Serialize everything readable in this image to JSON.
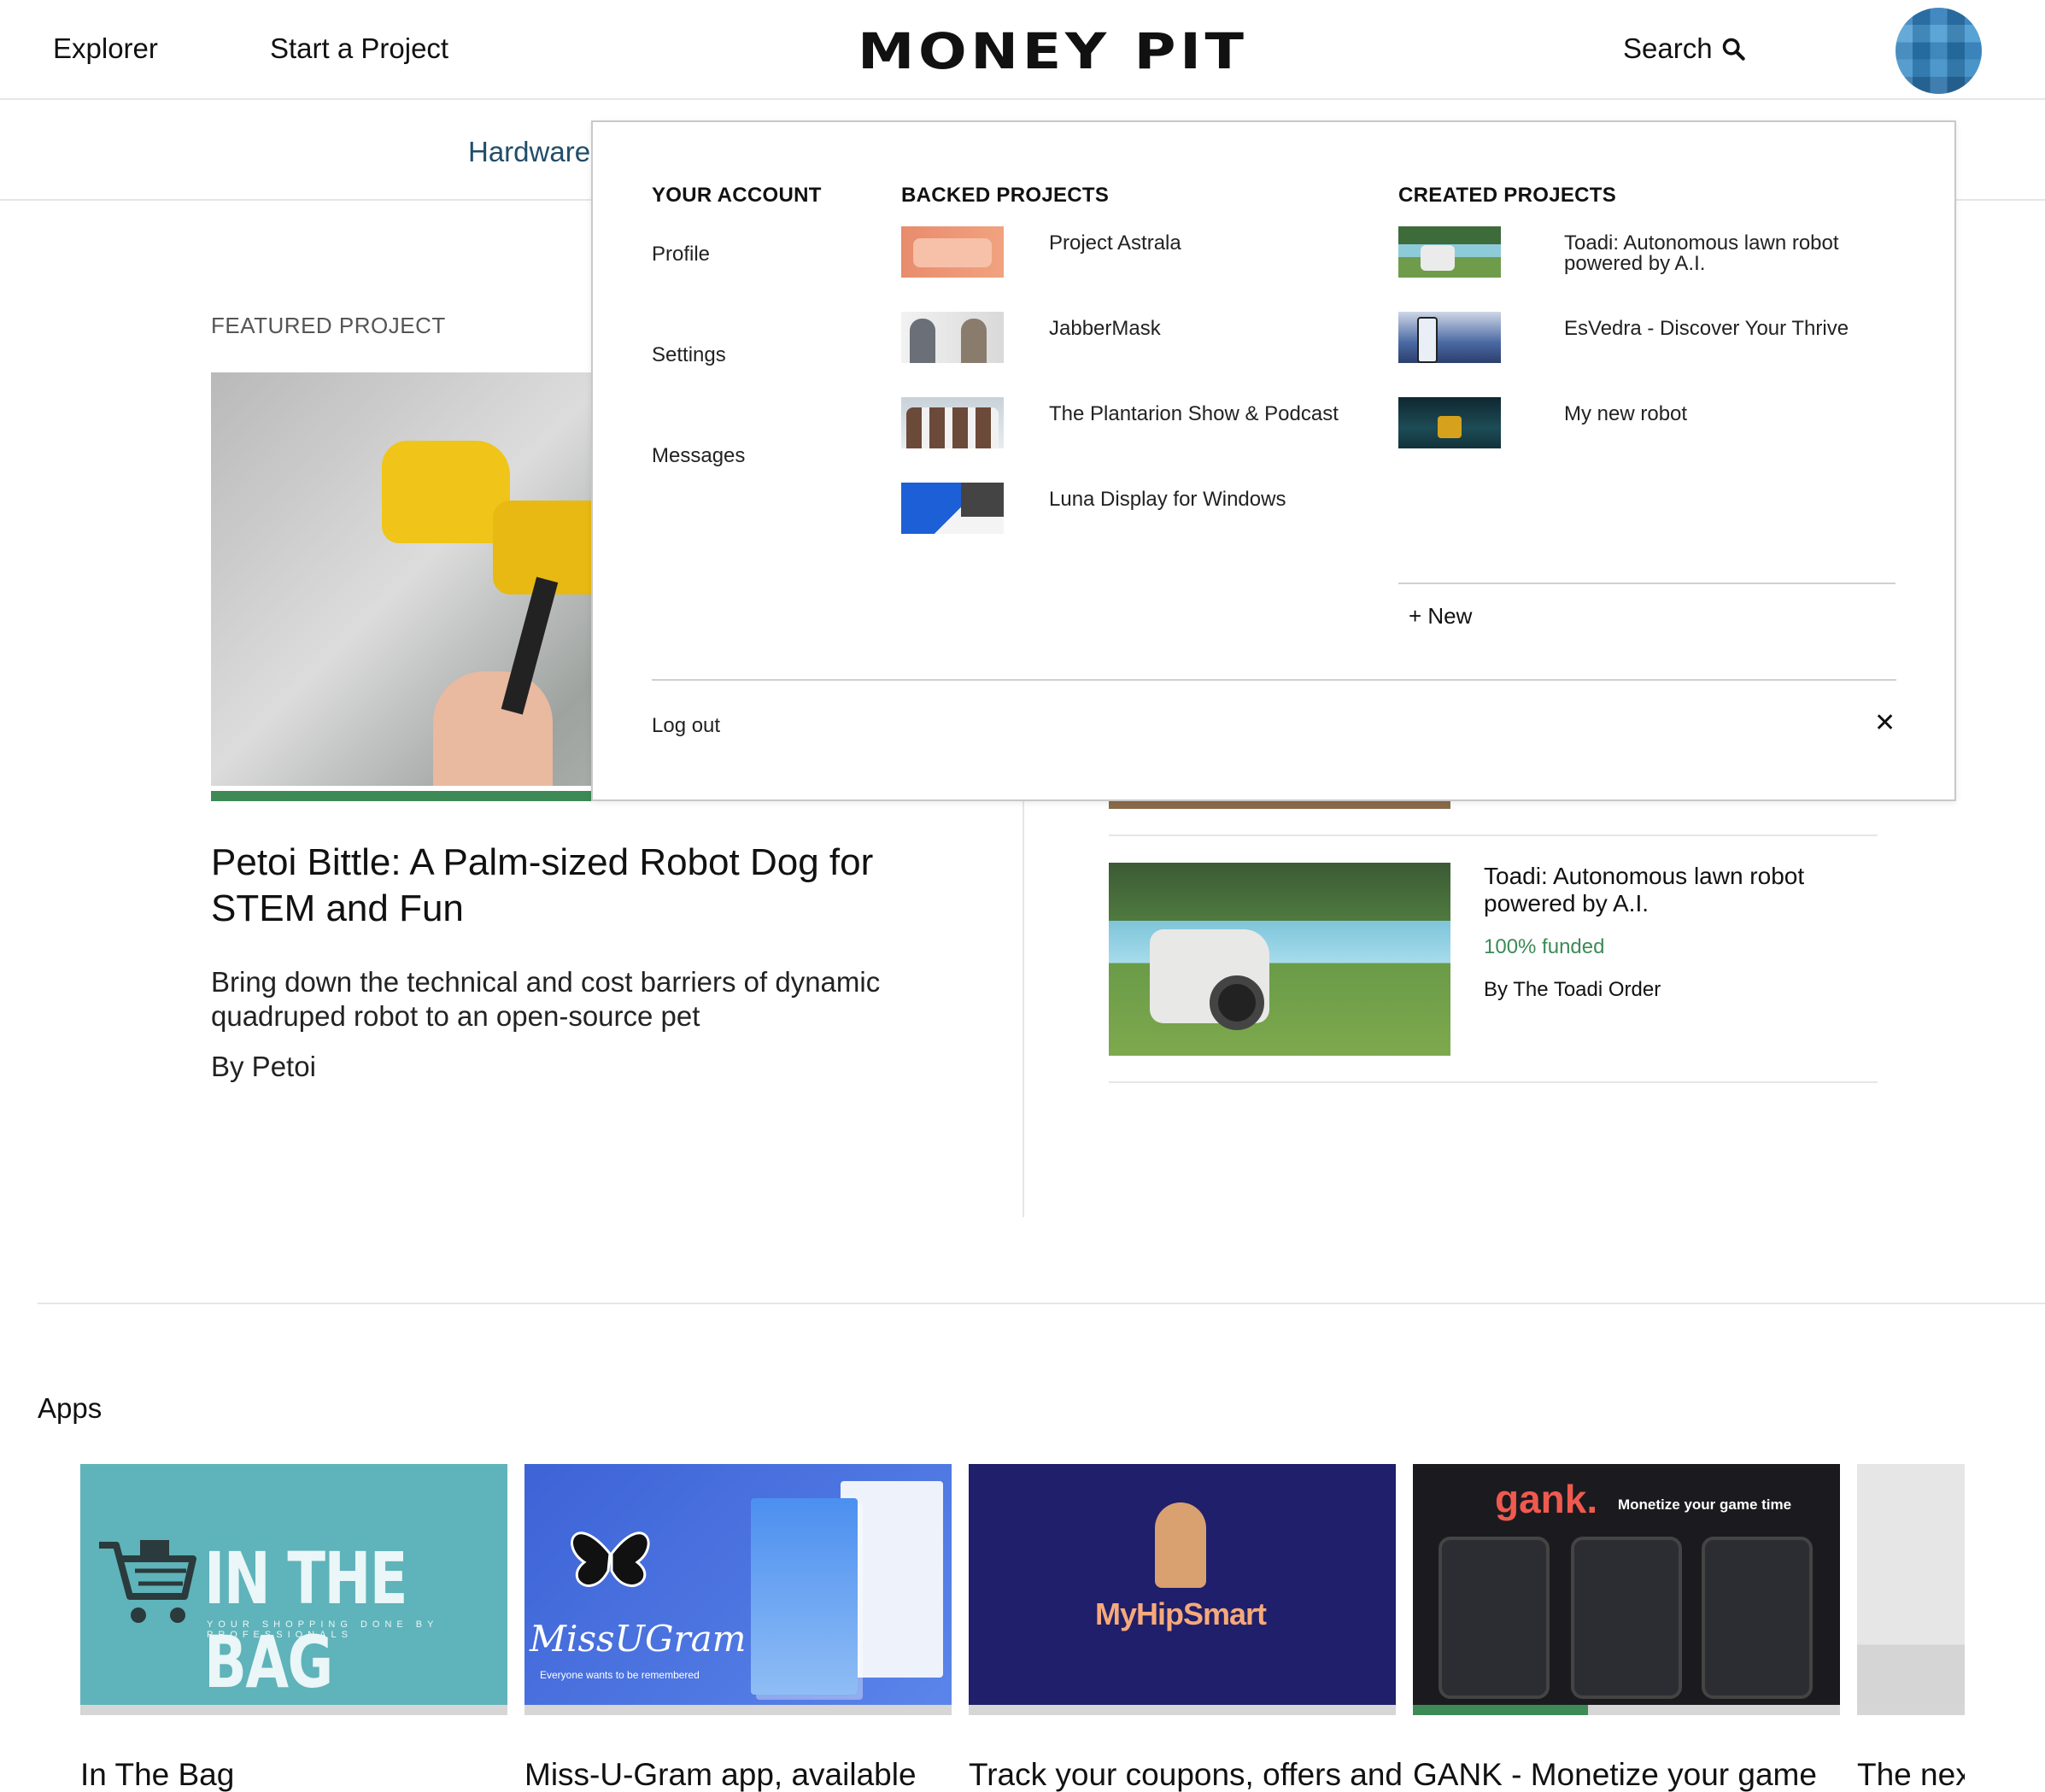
{
  "header": {
    "nav": [
      "Explorer",
      "Start a Project"
    ],
    "logo": "MONEY PIT",
    "search_label": "Search"
  },
  "subnav": {
    "category": "Hardware"
  },
  "featured": {
    "label": "FEATURED PROJECT",
    "title": "Petoi Bittle: A Palm-sized Robot Dog for STEM and Fun",
    "description": "Bring down the technical and cost barriers of dynamic quadruped robot to an open-source pet",
    "by": "By Petoi"
  },
  "side_project": {
    "title": "Toadi: Autonomous lawn robot powered by A.I.",
    "funded": "100% funded",
    "by": "By The Toadi Order"
  },
  "apps": {
    "heading": "Apps",
    "cards": [
      {
        "title": "In The Bag",
        "logo": "IN THE BAG",
        "tagline": "YOUR SHOPPING DONE BY PROFESSIONALS",
        "progress": 0
      },
      {
        "title": "Miss-U-Gram app, available",
        "logo": "MissUGram",
        "tagline": "Everyone wants to be remembered",
        "progress": 0
      },
      {
        "title": "Track your coupons, offers and",
        "logo": "MyHipSmart",
        "progress": 0
      },
      {
        "title": "GANK - Monetize your game",
        "logo": "gank.",
        "tagline": "Monetize your game time",
        "progress": 0.41
      },
      {
        "title": "The nex",
        "progress": 0
      }
    ]
  },
  "dropdown": {
    "account": {
      "heading": "YOUR ACCOUNT",
      "links": [
        "Profile",
        "Settings",
        "Messages"
      ]
    },
    "backed": {
      "heading": "BACKED PROJECTS",
      "items": [
        "Project Astrala",
        "JabberMask",
        "The Plantarion Show & Podcast",
        "Luna Display for Windows"
      ]
    },
    "created": {
      "heading": "CREATED PROJECTS",
      "items": [
        "Toadi: Autonomous lawn robot powered by A.I.",
        "EsVedra - Discover Your Thrive",
        "My new robot"
      ],
      "new_label": "+ New"
    },
    "logout": "Log out",
    "close": "✕"
  },
  "colors": {
    "accent_green": "#3d8a57",
    "link_blue": "#214e6a"
  }
}
